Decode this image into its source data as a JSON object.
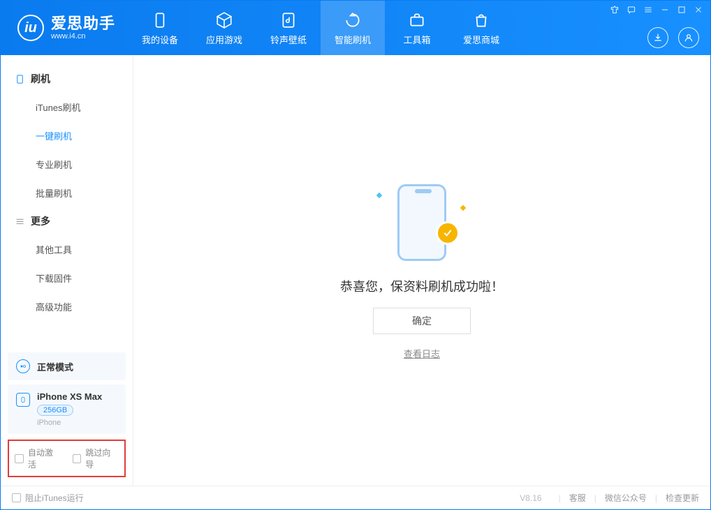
{
  "app": {
    "title": "爱思助手",
    "subtitle": "www.i4.cn"
  },
  "nav": {
    "items": [
      {
        "label": "我的设备",
        "icon": "device"
      },
      {
        "label": "应用游戏",
        "icon": "cube"
      },
      {
        "label": "铃声壁纸",
        "icon": "music"
      },
      {
        "label": "智能刷机",
        "icon": "refresh",
        "active": true
      },
      {
        "label": "工具箱",
        "icon": "toolbox"
      },
      {
        "label": "爱思商城",
        "icon": "bag"
      }
    ]
  },
  "sidebar": {
    "group1": {
      "title": "刷机",
      "items": [
        "iTunes刷机",
        "一键刷机",
        "专业刷机",
        "批量刷机"
      ],
      "active_index": 1
    },
    "group2": {
      "title": "更多",
      "items": [
        "其他工具",
        "下载固件",
        "高级功能"
      ]
    },
    "mode_label": "正常模式",
    "device": {
      "name": "iPhone XS Max",
      "capacity": "256GB",
      "type": "iPhone"
    },
    "options": {
      "auto_activate": "自动激活",
      "skip_guide": "跳过向导"
    }
  },
  "main": {
    "success_text": "恭喜您，保资料刷机成功啦！",
    "ok_button": "确定",
    "view_log": "查看日志"
  },
  "footer": {
    "block_itunes": "阻止iTunes运行",
    "version": "V8.16",
    "links": [
      "客服",
      "微信公众号",
      "检查更新"
    ]
  }
}
